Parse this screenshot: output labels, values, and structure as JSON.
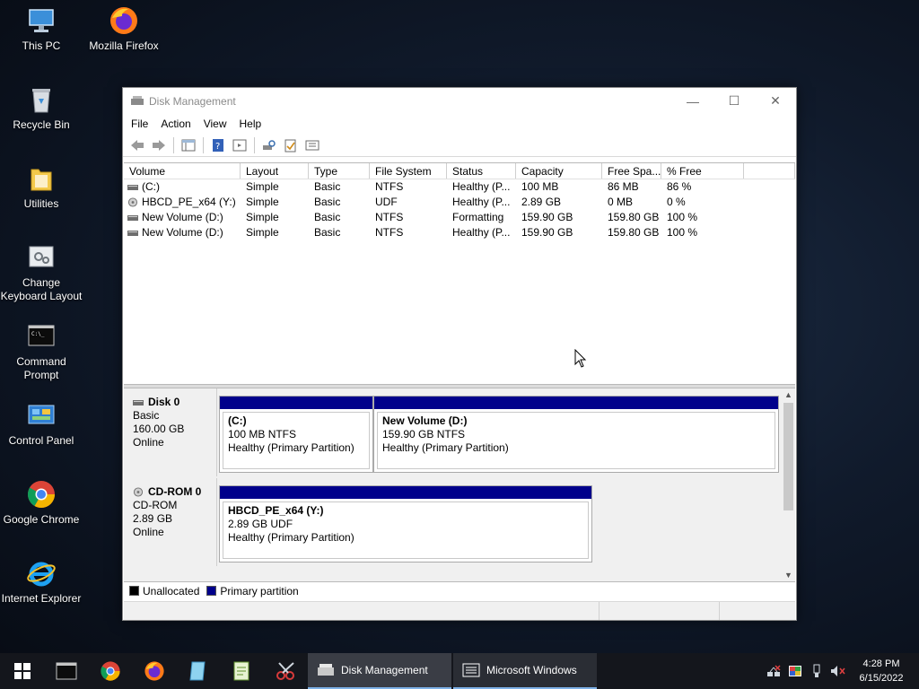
{
  "desktop": {
    "icons": [
      {
        "label": "This PC"
      },
      {
        "label": "Mozilla Firefox"
      },
      {
        "label": "Recycle Bin"
      },
      {
        "label": "Utilities"
      },
      {
        "label": "Change Keyboard Layout"
      },
      {
        "label": "Command Prompt"
      },
      {
        "label": "Control Panel"
      },
      {
        "label": "Google Chrome"
      },
      {
        "label": "Internet Explorer"
      }
    ]
  },
  "window": {
    "title": "Disk Management",
    "controls": {
      "minimize": "—",
      "maximize": "☐",
      "close": "✕"
    },
    "menu": [
      "File",
      "Action",
      "View",
      "Help"
    ],
    "columns": [
      "Volume",
      "Layout",
      "Type",
      "File System",
      "Status",
      "Capacity",
      "Free Spa...",
      "% Free"
    ],
    "volumes": [
      {
        "volume": "(C:)",
        "layout": "Simple",
        "type": "Basic",
        "fs": "NTFS",
        "status": "Healthy (P...",
        "capacity": "100 MB",
        "free": "86 MB",
        "pct": "86 %",
        "icon": "disk-icon"
      },
      {
        "volume": "HBCD_PE_x64 (Y:)",
        "layout": "Simple",
        "type": "Basic",
        "fs": "UDF",
        "status": "Healthy (P...",
        "capacity": "2.89 GB",
        "free": "0 MB",
        "pct": "0 %",
        "icon": "cd-icon"
      },
      {
        "volume": "New Volume (D:)",
        "layout": "Simple",
        "type": "Basic",
        "fs": "NTFS",
        "status": "Formatting",
        "capacity": "159.90 GB",
        "free": "159.80 GB",
        "pct": "100 %",
        "icon": "disk-icon"
      },
      {
        "volume": "New Volume (D:)",
        "layout": "Simple",
        "type": "Basic",
        "fs": "NTFS",
        "status": "Healthy (P...",
        "capacity": "159.90 GB",
        "free": "159.80 GB",
        "pct": "100 %",
        "icon": "disk-icon"
      }
    ],
    "disks": [
      {
        "name": "Disk 0",
        "type": "Basic",
        "size": "160.00 GB",
        "state": "Online",
        "partitions": [
          {
            "name": "(C:)",
            "size_fs": "100 MB NTFS",
            "status": "Healthy (Primary Partition)"
          },
          {
            "name": "New Volume  (D:)",
            "size_fs": "159.90 GB NTFS",
            "status": "Healthy (Primary Partition)"
          }
        ]
      },
      {
        "name": "CD-ROM 0",
        "type": "CD-ROM",
        "size": "2.89 GB",
        "state": "Online",
        "partitions": [
          {
            "name": "HBCD_PE_x64  (Y:)",
            "size_fs": "2.89 GB UDF",
            "status": "Healthy (Primary Partition)"
          }
        ]
      }
    ],
    "legend": [
      {
        "label": "Unallocated",
        "color": "#000000"
      },
      {
        "label": "Primary partition",
        "color": "#00008b"
      }
    ]
  },
  "taskbar": {
    "windows": [
      {
        "label": "Disk Management"
      },
      {
        "label": "Microsoft Windows"
      }
    ],
    "clock": {
      "time": "4:28 PM",
      "date": "6/15/2022"
    }
  },
  "colors": {
    "primary_partition": "#00008b",
    "taskbar": "#14161c",
    "active_underline": "#7db0e6"
  }
}
